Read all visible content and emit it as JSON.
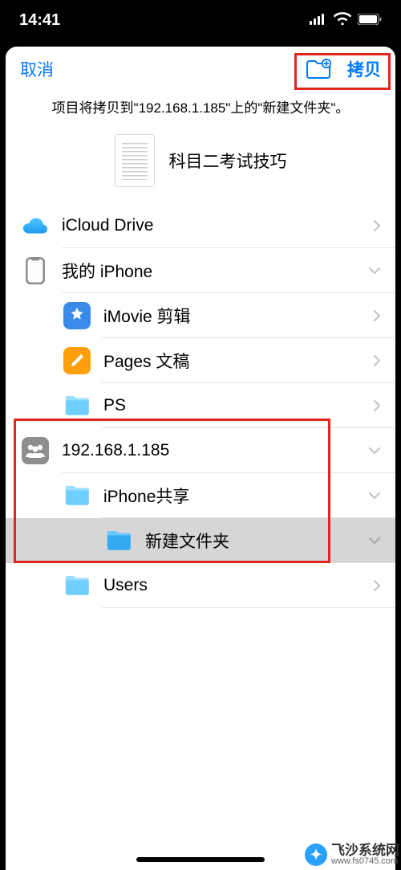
{
  "status": {
    "time": "14:41"
  },
  "header": {
    "cancel": "取消",
    "copy": "拷贝"
  },
  "subtitle": "项目将拷贝到\"192.168.1.185\"上的\"新建文件夹\"。",
  "file": {
    "name": "科目二考试技巧"
  },
  "rows": {
    "icloud": "iCloud Drive",
    "iphone": "我的 iPhone",
    "imovie": "iMovie 剪辑",
    "pages": "Pages 文稿",
    "ps": "PS",
    "server": "192.168.1.185",
    "share": "iPhone共享",
    "newfolder": "新建文件夹",
    "users": "Users"
  },
  "watermark": {
    "name": "飞沙系统网",
    "url": "www.fs0745.com"
  }
}
